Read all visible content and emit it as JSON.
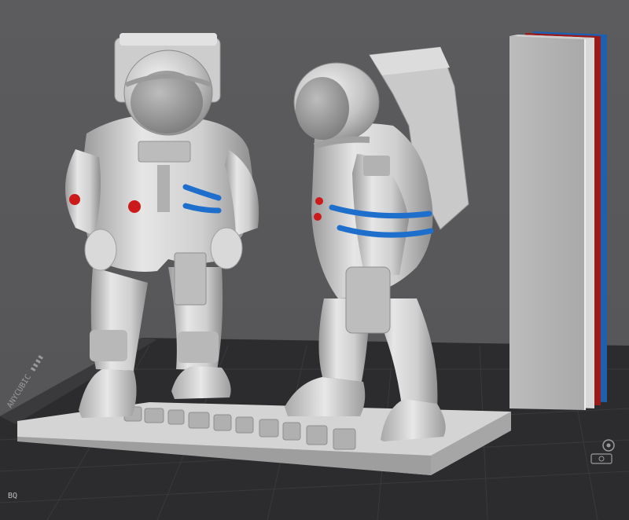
{
  "scene": {
    "background_color": "#5a5a5c",
    "bed_color": "#2c2c2e",
    "bed_grid_color": "#3a3a3c",
    "model_color": "#c9c9c9",
    "accent_colors": {
      "red": "#cc1a1a",
      "blue": "#1e6fcc"
    }
  },
  "bed": {
    "corner_label": "BQ",
    "side_label": "ANYCUBIC ▮▮▮▮",
    "icons": [
      "settings-icon",
      "camera-icon"
    ]
  },
  "objects": [
    {
      "name": "astronaut-front"
    },
    {
      "name": "astronaut-side"
    },
    {
      "name": "tower-block"
    },
    {
      "name": "base-plate"
    }
  ]
}
